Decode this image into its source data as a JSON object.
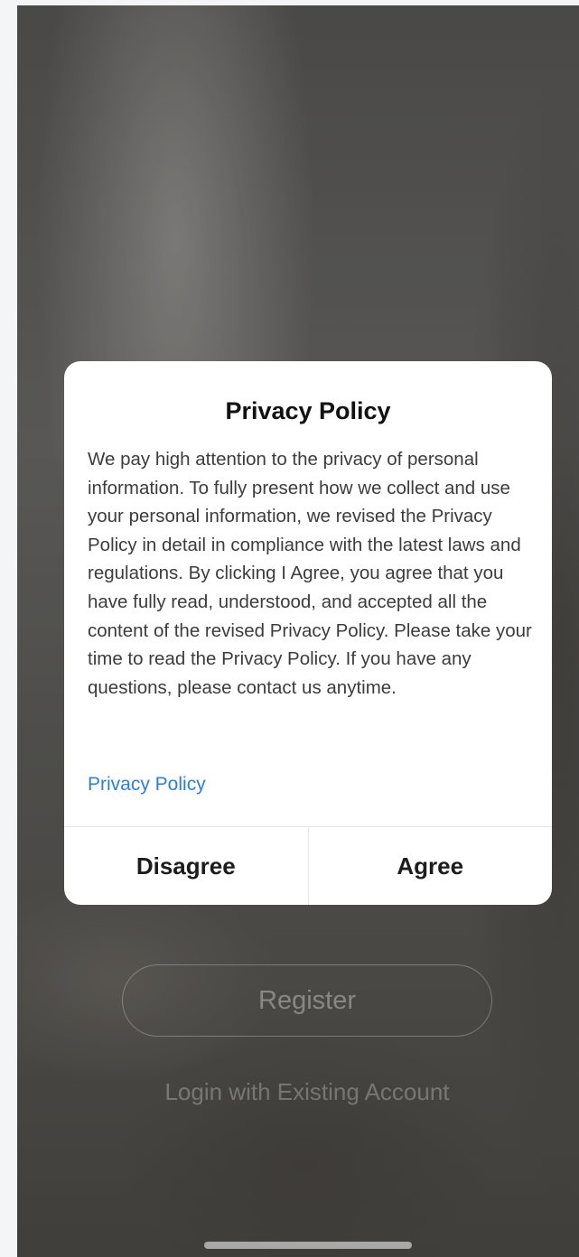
{
  "background": {
    "register_label": "Register",
    "login_label": "Login with Existing Account"
  },
  "dialog": {
    "title": "Privacy Policy",
    "body": "We pay high attention to the privacy of personal information. To fully present how we collect and use your personal information, we revised the Privacy Policy in detail in compliance with the latest laws and regulations. By clicking I Agree, you agree that you have fully read, understood, and accepted all the content of the revised Privacy Policy. Please take your time to read the Privacy Policy. If you have any questions, please contact us anytime.",
    "link_label": "Privacy Policy",
    "disagree_label": "Disagree",
    "agree_label": "Agree"
  },
  "colors": {
    "link": "#2f7ed8",
    "dialog_bg": "#ffffff",
    "title": "#111111"
  }
}
